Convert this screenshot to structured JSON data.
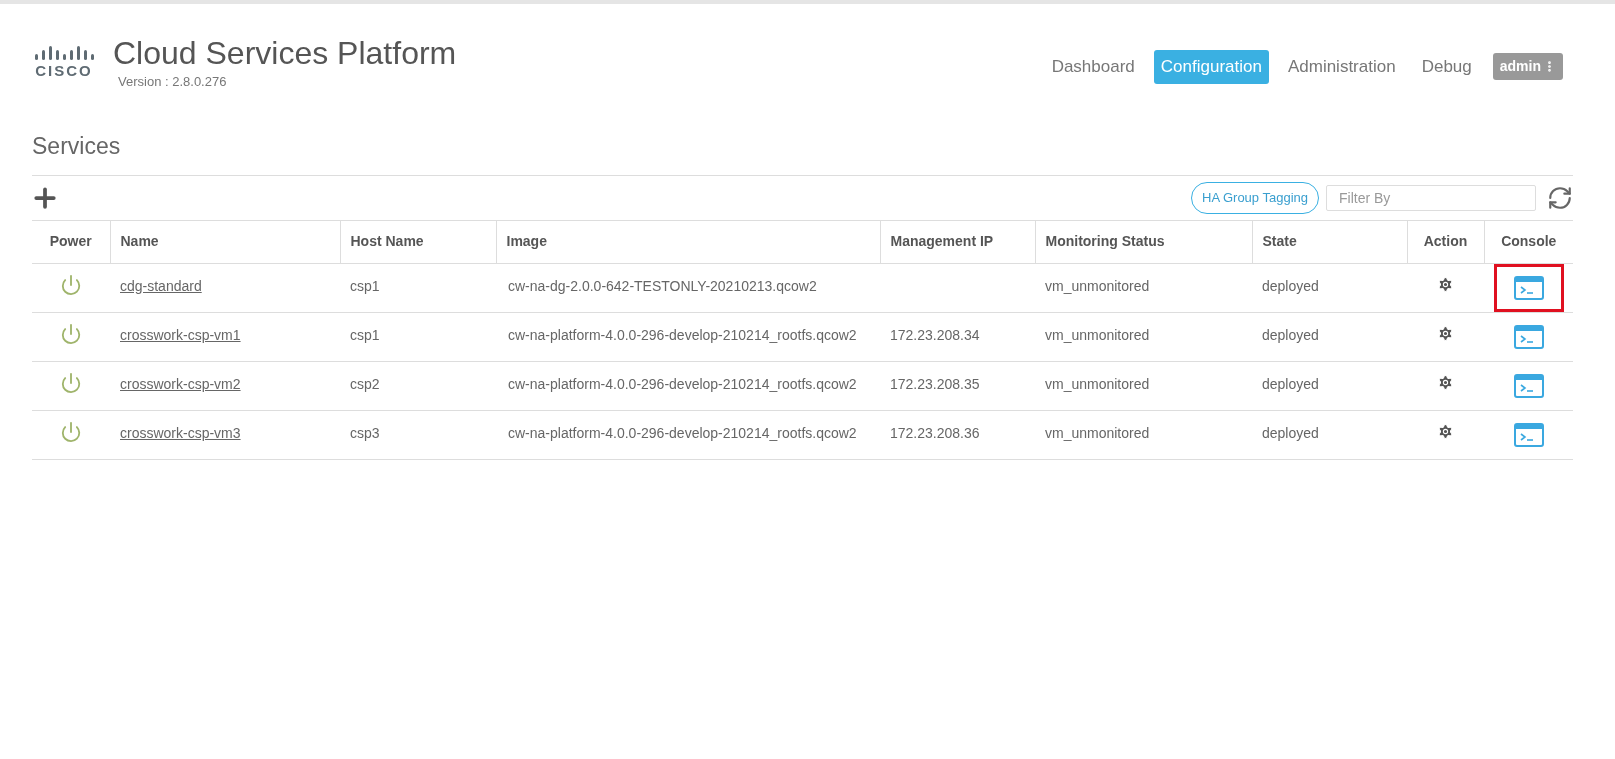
{
  "header": {
    "logo_text": "CISCO",
    "title": "Cloud Services Platform",
    "version": "Version : 2.8.0.276"
  },
  "nav": [
    {
      "label": "Dashboard",
      "selected": false
    },
    {
      "label": "Configuration",
      "selected": true
    },
    {
      "label": "Administration",
      "selected": false
    },
    {
      "label": "Debug",
      "selected": false
    }
  ],
  "user_menu": {
    "label": "admin"
  },
  "page_title": "Services",
  "toolbar": {
    "tag_button": "HA Group Tagging",
    "filter": {
      "placeholder": "Filter By"
    }
  },
  "table": {
    "columns": [
      "Power",
      "Name",
      "Host Name",
      "Image",
      "Management IP",
      "Monitoring Status",
      "State",
      "Action",
      "Console"
    ],
    "rows": [
      {
        "power_on": true,
        "name": "cdg-standard",
        "host": "csp1",
        "image": "cw-na-dg-2.0.0-642-TESTONLY-20210213.qcow2",
        "ip": "",
        "monitoring": "vm_unmonitored",
        "state": "deployed",
        "console_highlighted": true
      },
      {
        "power_on": true,
        "name": "crosswork-csp-vm1",
        "host": "csp1",
        "image": "cw-na-platform-4.0.0-296-develop-210214_rootfs.qcow2",
        "ip": "172.23.208.34",
        "monitoring": "vm_unmonitored",
        "state": "deployed",
        "console_highlighted": false
      },
      {
        "power_on": true,
        "name": "crosswork-csp-vm2",
        "host": "csp2",
        "image": "cw-na-platform-4.0.0-296-develop-210214_rootfs.qcow2",
        "ip": "172.23.208.35",
        "monitoring": "vm_unmonitored",
        "state": "deployed",
        "console_highlighted": false
      },
      {
        "power_on": true,
        "name": "crosswork-csp-vm3",
        "host": "csp3",
        "image": "cw-na-platform-4.0.0-296-develop-210214_rootfs.qcow2",
        "ip": "172.23.208.36",
        "monitoring": "vm_unmonitored",
        "state": "deployed",
        "console_highlighted": false
      }
    ]
  }
}
